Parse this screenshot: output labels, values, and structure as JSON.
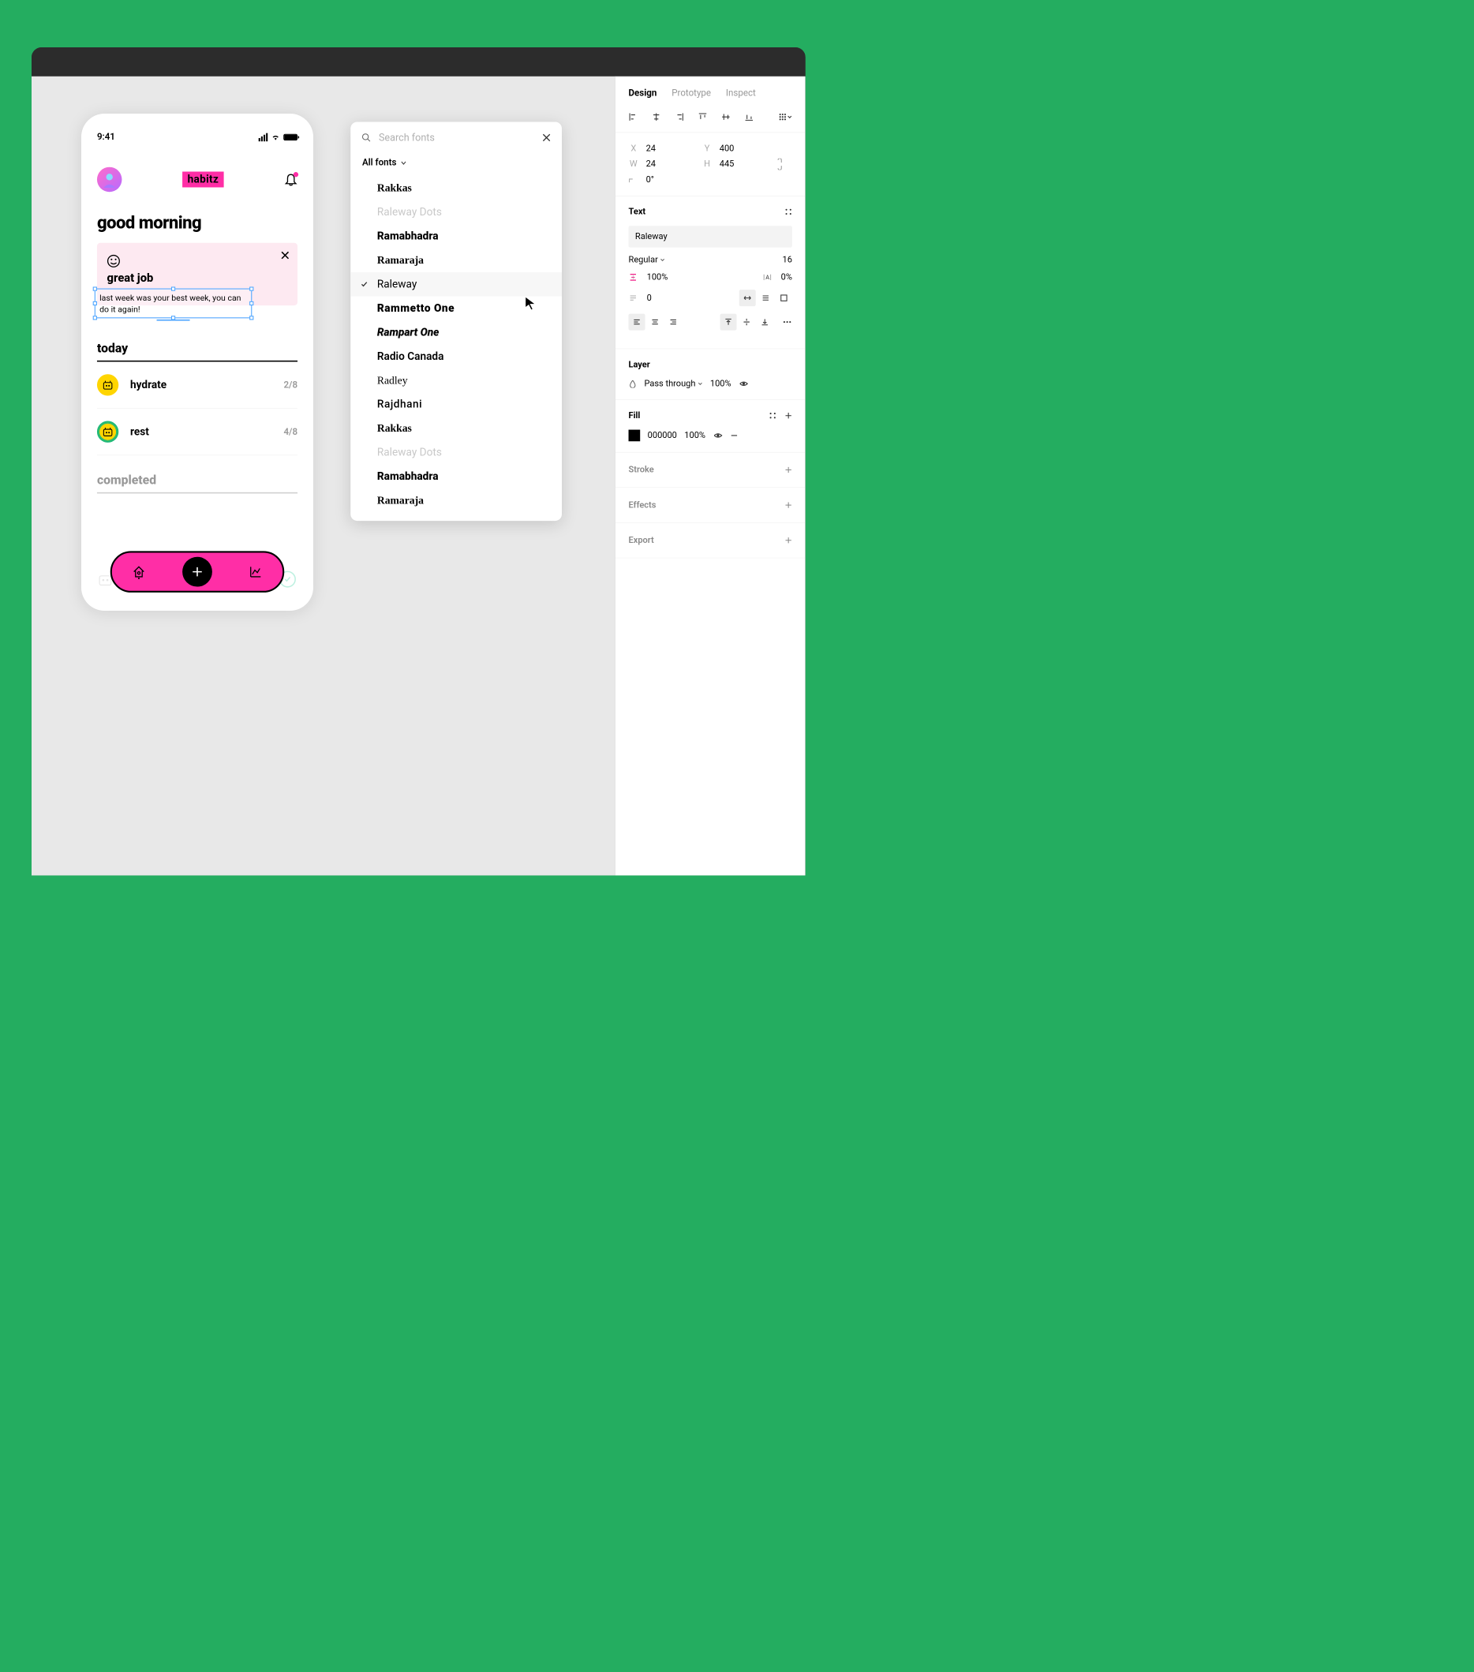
{
  "phone": {
    "time": "9:41",
    "brand_main": "habit",
    "brand_suffix": "z",
    "greeting": "good morning",
    "card": {
      "title": "great job",
      "body": "last week was your best week, you can do it again!"
    },
    "today_label": "today",
    "completed_label": "completed",
    "habits": [
      {
        "name": "hydrate",
        "count": "2/8"
      },
      {
        "name": "rest",
        "count": "4/8"
      }
    ]
  },
  "font_picker": {
    "placeholder": "Search fonts",
    "filter_label": "All fonts",
    "selected": "Raleway",
    "items": [
      {
        "label": "Rakkas",
        "dim": false,
        "style": "font-family:serif;font-weight:700"
      },
      {
        "label": "Raleway Dots",
        "dim": true,
        "style": ""
      },
      {
        "label": "Ramabhadra",
        "dim": false,
        "style": "font-weight:800"
      },
      {
        "label": "Ramaraja",
        "dim": false,
        "style": "font-family:serif;font-weight:700"
      },
      {
        "label": "Raleway",
        "dim": false,
        "style": "",
        "selected": true
      },
      {
        "label": "Rammetto One",
        "dim": false,
        "style": "font-weight:900;letter-spacing:1px"
      },
      {
        "label": "Rampart One",
        "dim": false,
        "style": "font-weight:800;font-style:italic;text-shadow:1px 1px #ccc"
      },
      {
        "label": "Radio Canada",
        "dim": false,
        "style": "font-weight:600"
      },
      {
        "label": "Radley",
        "dim": false,
        "style": "font-family:serif"
      },
      {
        "label": "Rajdhani",
        "dim": false,
        "style": "font-weight:500;letter-spacing:1px"
      },
      {
        "label": "Rakkas",
        "dim": false,
        "style": "font-family:serif;font-weight:700"
      },
      {
        "label": "Raleway Dots",
        "dim": true,
        "style": ""
      },
      {
        "label": "Ramabhadra",
        "dim": false,
        "style": "font-weight:800"
      },
      {
        "label": "Ramaraja",
        "dim": false,
        "style": "font-family:serif;font-weight:700"
      }
    ]
  },
  "inspector": {
    "tabs": {
      "design": "Design",
      "prototype": "Prototype",
      "inspect": "Inspect"
    },
    "position": {
      "x_label": "X",
      "x": "24",
      "y_label": "Y",
      "y": "400",
      "w_label": "W",
      "w": "24",
      "h_label": "H",
      "h": "445",
      "r_label": "⌐",
      "r": "0°"
    },
    "text": {
      "title": "Text",
      "font": "Raleway",
      "weight": "Regular",
      "size": "16",
      "line_height": "100%",
      "letter_spacing": "0%",
      "paragraph": "0"
    },
    "layer": {
      "title": "Layer",
      "blend": "Pass through",
      "opacity": "100%"
    },
    "fill": {
      "title": "Fill",
      "hex": "000000",
      "opacity": "100%"
    },
    "stroke": "Stroke",
    "effects": "Effects",
    "export": "Export"
  }
}
